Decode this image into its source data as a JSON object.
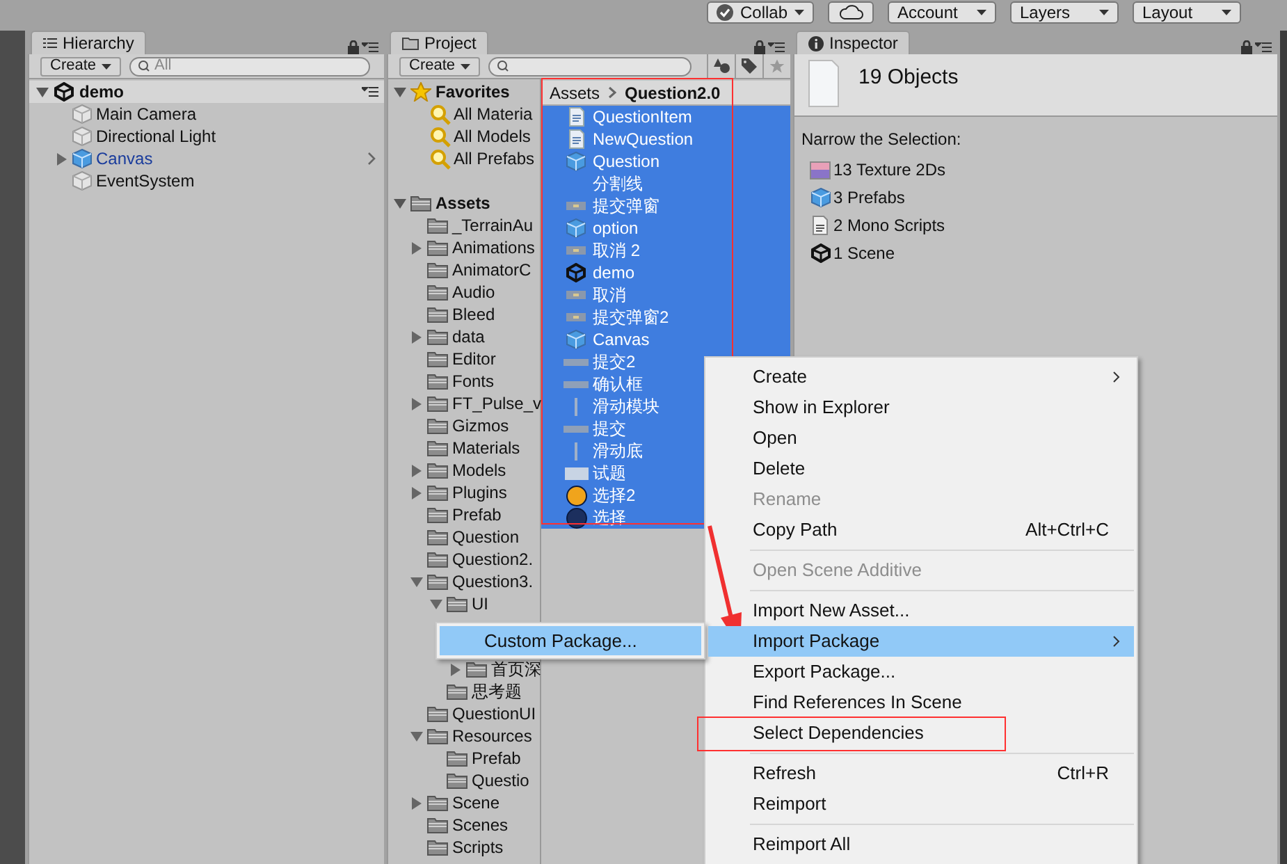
{
  "toolbar": {
    "buttons": [
      {
        "label": "Collab",
        "kind": "check-dropdown"
      },
      {
        "kind": "cloud"
      },
      {
        "label": "Account",
        "kind": "dropdown"
      },
      {
        "label": "Layers",
        "kind": "dropdown"
      },
      {
        "label": "Layout",
        "kind": "dropdown"
      }
    ]
  },
  "hierarchy": {
    "tab": "Hierarchy",
    "create": "Create",
    "search_placeholder": "All",
    "scene": {
      "label": "demo",
      "expanded": true,
      "children": [
        {
          "label": "Main Camera",
          "kind": "object",
          "expandable": false
        },
        {
          "label": "Directional Light",
          "kind": "object",
          "expandable": false
        },
        {
          "label": "Canvas",
          "kind": "prefab",
          "expandable": true,
          "expanded": false
        },
        {
          "label": "EventSystem",
          "kind": "object",
          "expandable": false
        }
      ]
    }
  },
  "project": {
    "tab": "Project",
    "create": "Create",
    "favorites": {
      "label": "Favorites",
      "expanded": true,
      "children": [
        {
          "label": "All Materia"
        },
        {
          "label": "All Models"
        },
        {
          "label": "All Prefabs"
        }
      ]
    },
    "assets": {
      "label": "Assets",
      "expanded": true,
      "children": [
        {
          "label": "_TerrainAu",
          "expandable": false
        },
        {
          "label": "Animations",
          "expandable": true,
          "expanded": false
        },
        {
          "label": "AnimatorC",
          "expandable": false
        },
        {
          "label": "Audio",
          "expandable": false
        },
        {
          "label": "Bleed",
          "expandable": false
        },
        {
          "label": "data",
          "expandable": true,
          "expanded": false
        },
        {
          "label": "Editor",
          "expandable": false
        },
        {
          "label": "Fonts",
          "expandable": false
        },
        {
          "label": "FT_Pulse_v",
          "expandable": true,
          "expanded": false
        },
        {
          "label": "Gizmos",
          "expandable": false
        },
        {
          "label": "Materials",
          "expandable": false
        },
        {
          "label": "Models",
          "expandable": true,
          "expanded": false
        },
        {
          "label": "Plugins",
          "expandable": true,
          "expanded": false
        },
        {
          "label": "Prefab",
          "expandable": false
        },
        {
          "label": "Question",
          "expandable": false
        },
        {
          "label": "Question2.",
          "expandable": false
        },
        {
          "label": "Question3.",
          "expandable": true,
          "expanded": true,
          "children": [
            {
              "label": "UI",
              "expandable": true,
              "expanded": true,
              "children": [
                {
                  "label": "首页深",
                  "expandable": true,
                  "expanded": false
                }
              ]
            },
            {
              "label": "思考题",
              "expandable": false
            }
          ]
        },
        {
          "label": "QuestionUI",
          "expandable": false
        },
        {
          "label": "Resources",
          "expandable": true,
          "expanded": true,
          "children": [
            {
              "label": "Prefab",
              "expandable": false
            },
            {
              "label": "Questio",
              "expandable": false
            }
          ]
        },
        {
          "label": "Scene",
          "expandable": true,
          "expanded": false
        },
        {
          "label": "Scenes",
          "expandable": false
        },
        {
          "label": "Scripts",
          "expandable": false
        }
      ]
    },
    "breadcrumb": [
      "Assets",
      "Question2.0"
    ],
    "listing": {
      "outlined": true,
      "items": [
        {
          "label": "QuestionItem",
          "kind": "script",
          "selected": true
        },
        {
          "label": "NewQuestion",
          "kind": "script",
          "selected": true
        },
        {
          "label": "Question",
          "kind": "prefab",
          "selected": true
        },
        {
          "label": "分割线",
          "kind": "blank",
          "selected": true
        },
        {
          "label": "提交弹窗",
          "kind": "button-sprite",
          "selected": true
        },
        {
          "label": "option",
          "kind": "prefab",
          "selected": true
        },
        {
          "label": "取消 2",
          "kind": "button-sprite",
          "selected": true
        },
        {
          "label": "demo",
          "kind": "scene",
          "selected": true
        },
        {
          "label": "取消",
          "kind": "button-sprite",
          "selected": true
        },
        {
          "label": "提交弹窗2",
          "kind": "button-sprite",
          "selected": true
        },
        {
          "label": "Canvas",
          "kind": "prefab",
          "selected": true
        },
        {
          "label": "提交2",
          "kind": "bar-sprite",
          "selected": true
        },
        {
          "label": "确认框",
          "kind": "bar-sprite",
          "selected": true
        },
        {
          "label": "滑动模块",
          "kind": "line-sprite",
          "selected": true
        },
        {
          "label": "提交",
          "kind": "bar-sprite",
          "selected": true
        },
        {
          "label": "滑动底",
          "kind": "line-sprite",
          "selected": true
        },
        {
          "label": "试题",
          "kind": "panel-sprite",
          "selected": true
        },
        {
          "label": "选择2",
          "kind": "orb",
          "color": "#f0a41c",
          "selected": true
        },
        {
          "label": "选择",
          "kind": "orb",
          "color": "#1c2f5e",
          "selected": true
        }
      ]
    }
  },
  "inspector": {
    "tab": "Inspector",
    "title": "19 Objects",
    "narrow_label": "Narrow the Selection:",
    "types": [
      {
        "label": "13 Texture 2Ds",
        "kind": "texture"
      },
      {
        "label": "3 Prefabs",
        "kind": "prefab"
      },
      {
        "label": "2 Mono Scripts",
        "kind": "script"
      },
      {
        "label": "1 Scene",
        "kind": "scene"
      }
    ]
  },
  "context_menu": {
    "items": [
      {
        "kind": "item",
        "label": "Create",
        "disabled": false,
        "selected": false,
        "submenu": true,
        "outlined": false
      },
      {
        "kind": "item",
        "label": "Show in Explorer",
        "disabled": false,
        "selected": false,
        "submenu": false,
        "outlined": false
      },
      {
        "kind": "item",
        "label": "Open",
        "disabled": false,
        "selected": false,
        "submenu": false,
        "outlined": false
      },
      {
        "kind": "item",
        "label": "Delete",
        "disabled": false,
        "selected": false,
        "submenu": false,
        "outlined": false
      },
      {
        "kind": "item",
        "label": "Rename",
        "disabled": true,
        "selected": false,
        "submenu": false,
        "outlined": false
      },
      {
        "kind": "item",
        "label": "Copy Path",
        "shortcut": "Alt+Ctrl+C",
        "disabled": false,
        "selected": false,
        "submenu": false,
        "outlined": false
      },
      {
        "kind": "separator"
      },
      {
        "kind": "item",
        "label": "Open Scene Additive",
        "disabled": true,
        "selected": false,
        "submenu": false,
        "outlined": false
      },
      {
        "kind": "separator"
      },
      {
        "kind": "item",
        "label": "Import New Asset...",
        "disabled": false,
        "selected": false,
        "submenu": false,
        "outlined": false
      },
      {
        "kind": "item",
        "label": "Import Package",
        "disabled": false,
        "selected": true,
        "submenu": true,
        "outlined": false
      },
      {
        "kind": "item",
        "label": "Export Package...",
        "disabled": false,
        "selected": false,
        "submenu": false,
        "outlined": false
      },
      {
        "kind": "item",
        "label": "Find References In Scene",
        "disabled": false,
        "selected": false,
        "submenu": false,
        "outlined": false
      },
      {
        "kind": "item",
        "label": "Select Dependencies",
        "disabled": false,
        "selected": false,
        "submenu": false,
        "outlined": true
      },
      {
        "kind": "separator"
      },
      {
        "kind": "item",
        "label": "Refresh",
        "shortcut": "Ctrl+R",
        "disabled": false,
        "selected": false,
        "submenu": false,
        "outlined": false
      },
      {
        "kind": "item",
        "label": "Reimport",
        "disabled": false,
        "selected": false,
        "submenu": false,
        "outlined": false
      },
      {
        "kind": "separator"
      },
      {
        "kind": "item",
        "label": "Reimport All",
        "disabled": false,
        "selected": false,
        "submenu": false,
        "outlined": false
      }
    ]
  },
  "submenu": {
    "items": [
      {
        "label": "Custom Package...",
        "selected": true
      }
    ]
  }
}
